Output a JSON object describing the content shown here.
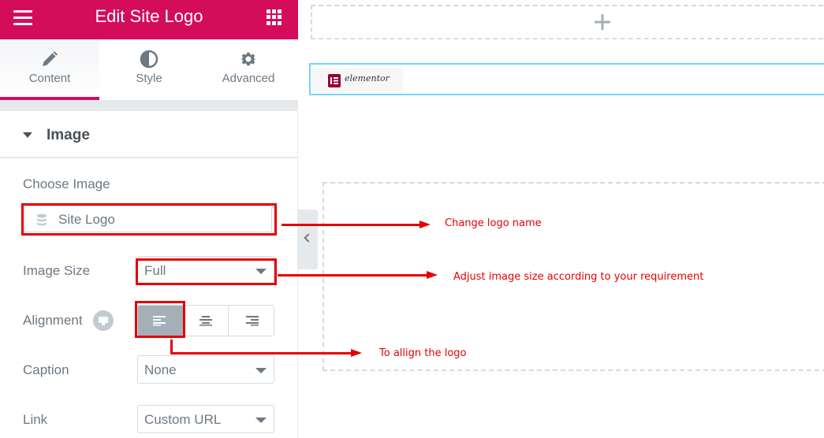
{
  "header": {
    "title": "Edit Site Logo",
    "menu_icon": "hamburger-icon",
    "widgets_icon": "grid-icon"
  },
  "tabs": [
    {
      "label": "Content",
      "icon": "pencil-icon",
      "active": true
    },
    {
      "label": "Style",
      "icon": "half-circle-icon",
      "active": false
    },
    {
      "label": "Advanced",
      "icon": "gear-icon",
      "active": false
    }
  ],
  "section": {
    "title": "Image",
    "choose_image_label": "Choose Image",
    "choose_image_value": "Site Logo",
    "image_size_label": "Image Size",
    "image_size_value": "Full",
    "alignment_label": "Alignment",
    "alignment_options": [
      "left",
      "center",
      "right"
    ],
    "alignment_selected": "left",
    "caption_label": "Caption",
    "caption_value": "None",
    "link_label": "Link",
    "link_value": "Custom URL"
  },
  "canvas": {
    "logo_text": "elementor"
  },
  "annotations": [
    {
      "text": "Change logo name",
      "target": "choose-image"
    },
    {
      "text": "Adjust image size according to your requirement",
      "target": "image-size"
    },
    {
      "text": "To allign the logo",
      "target": "alignment"
    }
  ],
  "colors": {
    "brand": "#d30c5c",
    "annotation": "#e60000",
    "selection_outline": "#71d7f7"
  }
}
